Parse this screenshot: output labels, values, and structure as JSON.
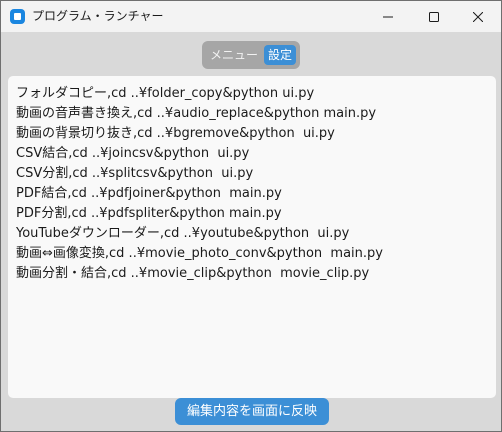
{
  "window": {
    "title": "プログラム・ランチャー"
  },
  "tabs": {
    "menu_label": "メニュー",
    "settings_label": "設定",
    "selected": "設定"
  },
  "editor": {
    "lines": [
      "フォルダコピー,cd ..¥folder_copy&python ui.py",
      "動画の音声書き換え,cd ..¥audio_replace&python main.py",
      "動画の背景切り抜き,cd ..¥bgremove&python  ui.py",
      "CSV結合,cd ..¥joincsv&python  ui.py",
      "CSV分割,cd ..¥splitcsv&python  ui.py",
      "PDF結合,cd ..¥pdfjoiner&python  main.py",
      "PDF分割,cd ..¥pdfspliter&python main.py",
      "YouTubeダウンローダー,cd ..¥youtube&python  ui.py",
      "動画⇔画像変換,cd ..¥movie_photo_conv&python  main.py",
      "動画分割・結合,cd ..¥movie_clip&python  movie_clip.py"
    ]
  },
  "actions": {
    "apply_label": "編集内容を画面に反映"
  },
  "colors": {
    "accent": "#3c8fd6",
    "segment_bg": "#a6a6a6",
    "window_bg": "#d9d9d9",
    "panel_bg": "#f9f9f9",
    "app_icon": "#1a86e0"
  },
  "icons": {
    "app": "app-icon",
    "minimize": "minimize-icon",
    "maximize": "maximize-icon",
    "close": "close-icon"
  }
}
